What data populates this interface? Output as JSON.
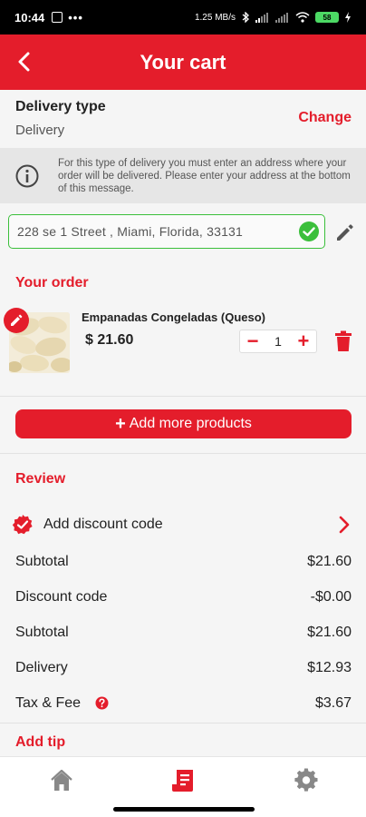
{
  "status_bar": {
    "time": "10:44",
    "dots": "•••",
    "network_speed": "1.25 MB/s",
    "battery": "58"
  },
  "header": {
    "title": "Your cart"
  },
  "delivery": {
    "label": "Delivery type",
    "value": "Delivery",
    "change_label": "Change"
  },
  "notice": {
    "text": "For this type of delivery you must enter an address where your order will be delivered. Please enter your address at the bottom of this message."
  },
  "address": {
    "value": "228 se 1 Street , Miami, Florida, 33131"
  },
  "order": {
    "title": "Your order",
    "items": [
      {
        "name": "Empanadas Congeladas (Queso)",
        "price": "$ 21.60",
        "quantity": "1"
      }
    ],
    "minus": "−",
    "plus": "+"
  },
  "add_more": {
    "plus": "+",
    "label": "Add more products"
  },
  "review": {
    "title": "Review",
    "discount_label": "Add discount code",
    "rows": [
      {
        "label": "Subtotal",
        "value": "$21.60"
      },
      {
        "label": "Discount code",
        "value": "-$0.00"
      },
      {
        "label": "Subtotal",
        "value": "$21.60"
      },
      {
        "label": "Delivery",
        "value": "$12.93"
      },
      {
        "label": "Tax & Fee",
        "value": "$3.67"
      }
    ]
  },
  "tip": {
    "title": "Add tip"
  },
  "colors": {
    "brand": "#e41d2b",
    "success": "#3bbf3b"
  },
  "icons": {
    "back": "chevron-left-icon",
    "info": "info-icon",
    "valid": "check-circle-icon",
    "edit": "pencil-icon",
    "trash": "trash-icon",
    "discount": "verified-badge-icon",
    "chevron": "chevron-right-icon",
    "help": "question-circle-icon",
    "nav_home": "home-icon",
    "nav_orders": "receipt-icon",
    "nav_settings": "gear-icon"
  }
}
